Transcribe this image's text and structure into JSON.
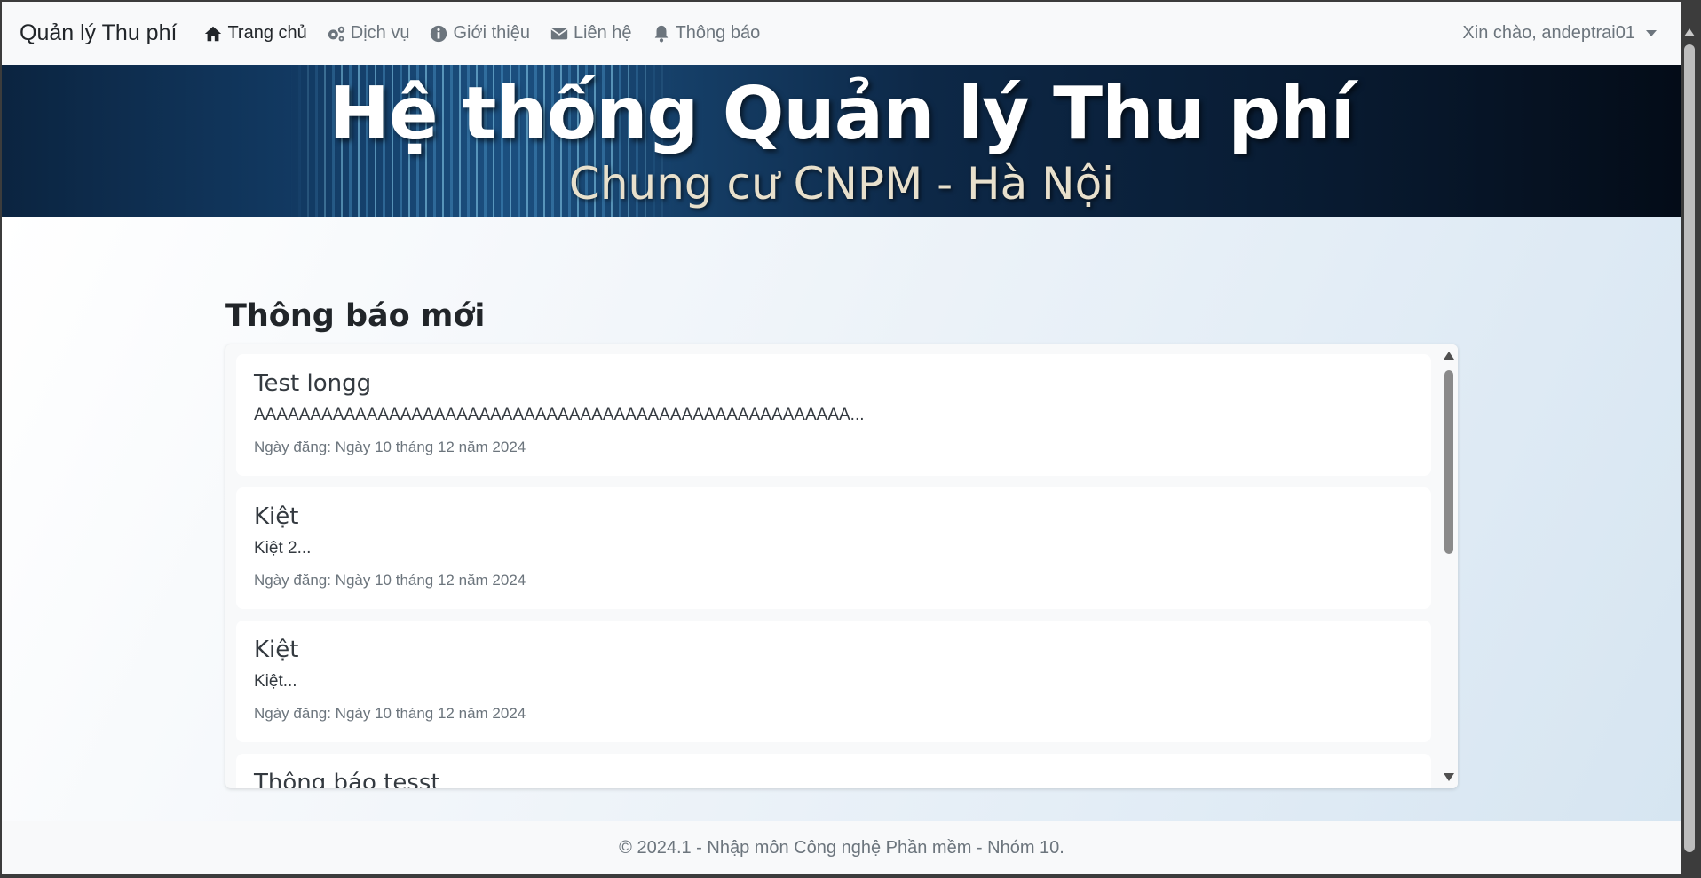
{
  "navbar": {
    "brand": "Quản lý Thu phí",
    "items": [
      {
        "label": "Trang chủ",
        "icon": "home-icon"
      },
      {
        "label": "Dịch vụ",
        "icon": "gears-icon"
      },
      {
        "label": "Giới thiệu",
        "icon": "info-icon"
      },
      {
        "label": "Liên hệ",
        "icon": "envelope-icon"
      },
      {
        "label": "Thông báo",
        "icon": "bell-icon"
      }
    ],
    "user_greeting": "Xin chào, andeptrai01"
  },
  "banner": {
    "title": "Hệ thống Quản lý Thu phí",
    "subtitle": "Chung cư CNPM - Hà Nội"
  },
  "main": {
    "section_title": "Thông báo mới",
    "notifications": [
      {
        "title": "Test longg",
        "content": "AAAAAAAAAAAAAAAAAAAAAAAAAAAAAAAAAAAAAAAAAAAAAAAAAAAAA...",
        "date": "Ngày đăng: Ngày 10 tháng 12 năm 2024"
      },
      {
        "title": "Kiệt",
        "content": "Kiệt 2...",
        "date": "Ngày đăng: Ngày 10 tháng 12 năm 2024"
      },
      {
        "title": "Kiệt",
        "content": "Kiệt...",
        "date": "Ngày đăng: Ngày 10 tháng 12 năm 2024"
      },
      {
        "title": "Thông báo tesst"
      }
    ]
  },
  "footer": {
    "text": "© 2024.1 - Nhập môn Công nghệ Phần mềm - Nhóm 10."
  },
  "colors": {
    "navbar_bg": "#f8f9fa",
    "text_dark": "#212529",
    "text_muted": "#6c757d",
    "banner_dark": "#0b2440"
  }
}
